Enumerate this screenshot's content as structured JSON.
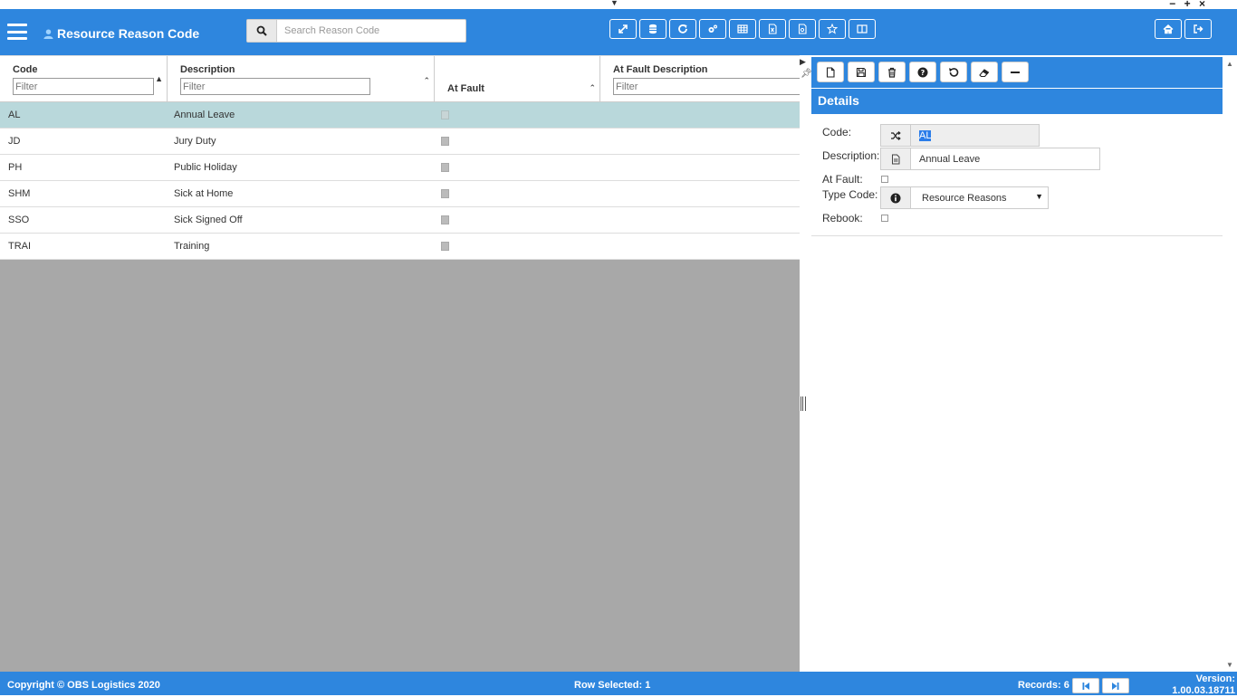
{
  "window": {
    "controls": "− + ×"
  },
  "header": {
    "title": "Resource Reason Code",
    "search_placeholder": "Search Reason Code"
  },
  "grid": {
    "columns": {
      "code": "Code",
      "description": "Description",
      "at_fault": "At Fault",
      "at_fault_description": "At Fault Description"
    },
    "filter_placeholder": "Filter",
    "rows": [
      {
        "code": "AL",
        "description": "Annual Leave",
        "selected": true
      },
      {
        "code": "JD",
        "description": "Jury Duty",
        "selected": false
      },
      {
        "code": "PH",
        "description": "Public Holiday",
        "selected": false
      },
      {
        "code": "SHM",
        "description": "Sick at Home",
        "selected": false
      },
      {
        "code": "SSO",
        "description": "Sick Signed Off",
        "selected": false
      },
      {
        "code": "TRAI",
        "description": "Training",
        "selected": false
      }
    ]
  },
  "details": {
    "title": "Details",
    "code_label": "Code:",
    "code_value": "AL",
    "description_label": "Description:",
    "description_value": "Annual Leave",
    "at_fault_label": "At Fault:",
    "type_code_label": "Type Code:",
    "type_code_value": "Resource Reasons",
    "rebook_label": "Rebook:"
  },
  "footer": {
    "copyright": "Copyright © OBS Logistics 2020",
    "row_selected": "Row Selected: 1",
    "records": "Records: 6",
    "version_label": "Version:",
    "version_value": "1.00.03.18711"
  },
  "colors": {
    "accent": "#2e86de",
    "selected_row": "#b9d8db",
    "grid_empty": "#a8a8a8"
  }
}
